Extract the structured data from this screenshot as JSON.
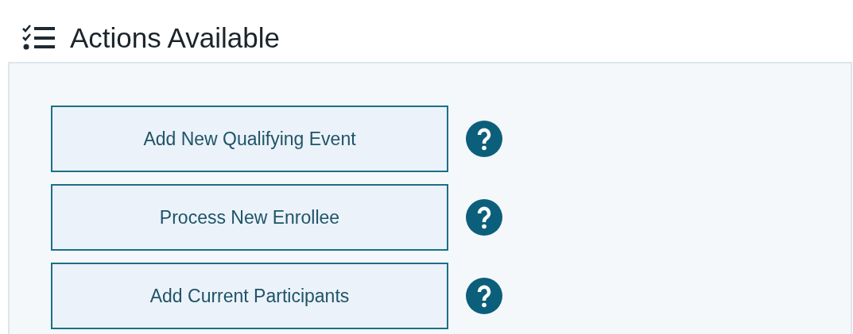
{
  "header": {
    "title": "Actions Available"
  },
  "actions": [
    {
      "label": "Add New Qualifying Event"
    },
    {
      "label": "Process New Enrollee"
    },
    {
      "label": "Add Current Participants"
    }
  ]
}
